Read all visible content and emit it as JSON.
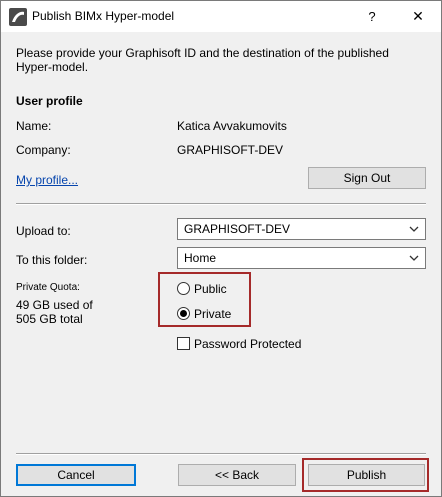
{
  "window": {
    "title": "Publish BIMx Hyper-model",
    "help_glyph": "?",
    "close_glyph": "✕"
  },
  "description": "Please provide your Graphisoft ID and the destination of the published Hyper-model.",
  "user_profile": {
    "heading": "User profile",
    "name_label": "Name:",
    "name_value": "Katica Avvakumovits",
    "company_label": "Company:",
    "company_value": "GRAPHISOFT-DEV",
    "my_profile_link": "My profile...",
    "sign_out_label": "Sign Out"
  },
  "upload": {
    "upload_to_label": "Upload to:",
    "upload_to_value": "GRAPHISOFT-DEV",
    "folder_label": "To this folder:",
    "folder_value": "Home",
    "quota_label": "Private Quota:",
    "quota_used": "49 GB used of",
    "quota_total": "505 GB total",
    "visibility_options": [
      "Public",
      "Private"
    ],
    "visibility_selected": "Private",
    "password_protected_label": "Password Protected",
    "password_protected_checked": false
  },
  "footer": {
    "cancel_label": "Cancel",
    "back_label": "<< Back",
    "publish_label": "Publish"
  },
  "colors": {
    "highlight": "#a52a2a",
    "link": "#0645ad",
    "dialog_bg": "#f0f0f0"
  }
}
